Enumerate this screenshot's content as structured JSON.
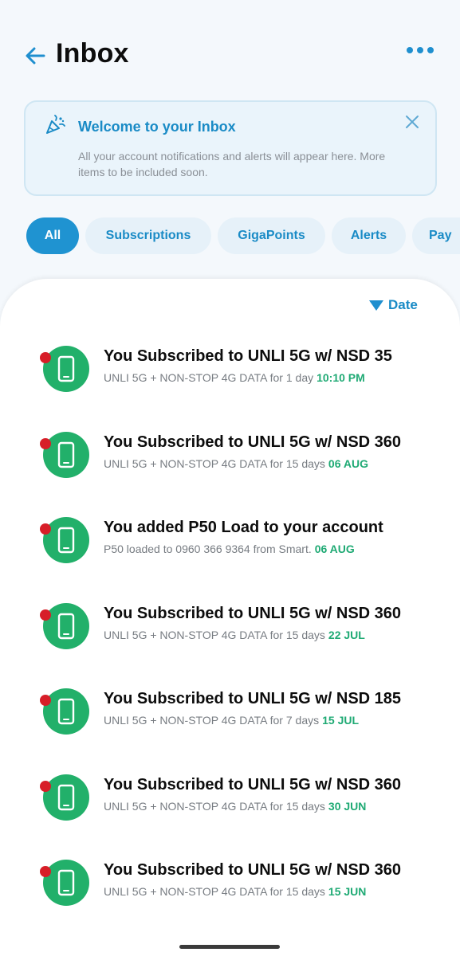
{
  "header": {
    "title": "Inbox"
  },
  "welcome": {
    "title": "Welcome to your Inbox",
    "body": "All your account notifications and alerts will appear here. More items to be included soon."
  },
  "filters": [
    {
      "label": "All",
      "selected": true
    },
    {
      "label": "Subscriptions",
      "selected": false
    },
    {
      "label": "GigaPoints",
      "selected": false
    },
    {
      "label": "Alerts",
      "selected": false
    },
    {
      "label": "Pay",
      "selected": false
    }
  ],
  "sort": {
    "label": "Date"
  },
  "messages": [
    {
      "title": "You Subscribed to UNLI 5G w/ NSD 35",
      "desc": "UNLI 5G + NON-STOP 4G DATA for 1 day",
      "date": "10:10 PM",
      "unread": true
    },
    {
      "title": "You Subscribed to UNLI 5G w/ NSD 360",
      "desc": "UNLI 5G + NON-STOP 4G DATA for 15 days",
      "date": "06 AUG",
      "unread": true
    },
    {
      "title": "You added P50 Load to your account",
      "desc": "P50 loaded to 0960 366 9364 from Smart.",
      "date": "06 AUG",
      "unread": true
    },
    {
      "title": "You Subscribed to UNLI 5G w/ NSD 360",
      "desc": "UNLI 5G + NON-STOP 4G DATA for 15 days",
      "date": "22 JUL",
      "unread": true
    },
    {
      "title": "You Subscribed to UNLI 5G w/ NSD 185",
      "desc": "UNLI 5G + NON-STOP 4G DATA for 7 days",
      "date": "15 JUL",
      "unread": true
    },
    {
      "title": "You Subscribed to UNLI 5G w/ NSD 360",
      "desc": "UNLI 5G + NON-STOP 4G DATA for 15 days",
      "date": "30 JUN",
      "unread": true
    },
    {
      "title": "You Subscribed to UNLI 5G w/ NSD 360",
      "desc": "UNLI 5G + NON-STOP 4G DATA for 15 days",
      "date": "15 JUN",
      "unread": true
    }
  ],
  "icons": {
    "back": "arrow-left-icon",
    "more": "more-horizontal-icon",
    "welcome": "party-popper-icon",
    "close": "close-icon",
    "sort": "triangle-down-icon",
    "message": "smartphone-icon"
  },
  "colors": {
    "accent": "#1f93d1",
    "chip_bg": "#e6f1f9",
    "avatar": "#22b06a",
    "unread": "#d71e28",
    "date": "#1faa74"
  }
}
